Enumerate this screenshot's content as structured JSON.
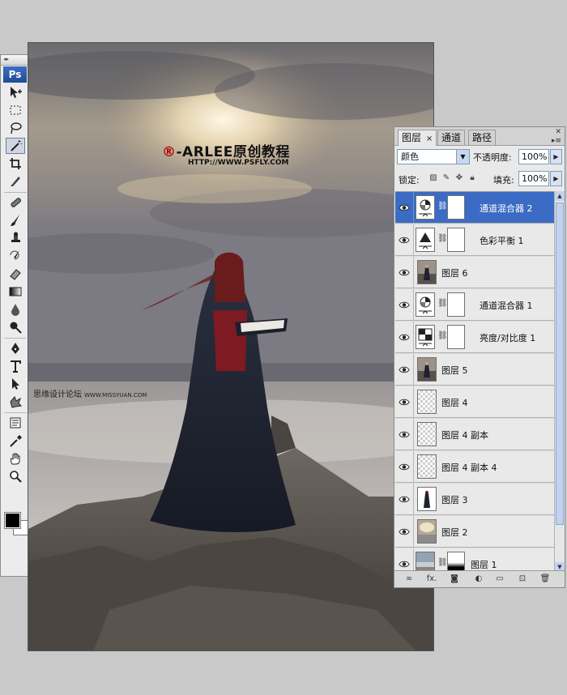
{
  "toolbar": {
    "logo": "Ps",
    "tools": [
      {
        "name": "move-tool",
        "icon": "move-icon"
      },
      {
        "name": "marquee-tool",
        "icon": "marquee-icon"
      },
      {
        "name": "lasso-tool",
        "icon": "lasso-icon"
      },
      {
        "name": "magic-wand-tool",
        "icon": "magic-wand-icon",
        "active": true
      },
      {
        "name": "crop-tool",
        "icon": "crop-icon"
      },
      {
        "name": "slice-tool",
        "icon": "slice-icon"
      },
      {
        "name": "healing-brush-tool",
        "icon": "bandage-icon"
      },
      {
        "name": "brush-tool",
        "icon": "brush-icon"
      },
      {
        "name": "clone-stamp-tool",
        "icon": "stamp-icon"
      },
      {
        "name": "history-brush-tool",
        "icon": "history-brush-icon"
      },
      {
        "name": "eraser-tool",
        "icon": "eraser-icon"
      },
      {
        "name": "gradient-tool",
        "icon": "gradient-icon"
      },
      {
        "name": "blur-tool",
        "icon": "blur-drop-icon"
      },
      {
        "name": "dodge-tool",
        "icon": "dodge-icon"
      },
      {
        "name": "pen-tool",
        "icon": "pen-icon"
      },
      {
        "name": "type-tool",
        "icon": "type-icon"
      },
      {
        "name": "path-selection-tool",
        "icon": "arrow-icon"
      },
      {
        "name": "shape-tool",
        "icon": "custom-shape-icon"
      },
      {
        "name": "notes-tool",
        "icon": "notes-icon"
      },
      {
        "name": "eyedropper-tool",
        "icon": "eyedropper-icon"
      },
      {
        "name": "hand-tool",
        "icon": "hand-icon"
      },
      {
        "name": "zoom-tool",
        "icon": "zoom-icon"
      }
    ],
    "foreground_color": "#000000",
    "background_color": "#ffffff"
  },
  "canvas": {
    "brand_symbol": "®",
    "brand_text": "-ARLEE原创教程",
    "brand_url": "HTTP://WWW.PSFLY.COM",
    "watermark_text": "思缘设计论坛",
    "watermark_url": "WWW.MISSYUAN.COM"
  },
  "layers_panel": {
    "tabs": [
      {
        "label": "图层",
        "active": true
      },
      {
        "label": "通道",
        "active": false
      },
      {
        "label": "路径",
        "active": false
      }
    ],
    "tab_close": "×",
    "blend_mode": "颜色",
    "opacity_label": "不透明度:",
    "opacity_value": "100%",
    "lock_label": "锁定:",
    "fill_label": "填充:",
    "fill_value": "100%",
    "layers": [
      {
        "name": "通道混合器 2",
        "thumb": "channel-mixer",
        "mask": true,
        "selected": true
      },
      {
        "name": "色彩平衡 1",
        "thumb": "color-balance",
        "mask": true,
        "selected": false
      },
      {
        "name": "图层 6",
        "thumb": "photo-girl",
        "mask": false,
        "selected": false
      },
      {
        "name": "通道混合器 1",
        "thumb": "channel-mixer",
        "mask": true,
        "selected": false
      },
      {
        "name": "亮度/对比度 1",
        "thumb": "brightness",
        "mask": true,
        "selected": false
      },
      {
        "name": "图层 5",
        "thumb": "photo-girl",
        "mask": false,
        "selected": false
      },
      {
        "name": "图层 4",
        "thumb": "transparent",
        "mask": false,
        "selected": false
      },
      {
        "name": "图层 4 副本",
        "thumb": "transparent",
        "mask": false,
        "selected": false
      },
      {
        "name": "图层 4 副本 4",
        "thumb": "transparent",
        "mask": false,
        "selected": false
      },
      {
        "name": "图层 3",
        "thumb": "figure",
        "mask": false,
        "selected": false
      },
      {
        "name": "图层 2",
        "thumb": "sky",
        "mask": false,
        "selected": false
      },
      {
        "name": "图层 1",
        "thumb": "photo-sea",
        "mask": true,
        "selected": false
      }
    ],
    "bottom_buttons": [
      {
        "name": "link-layers-button",
        "icon": "link-icon",
        "glyph": "∞"
      },
      {
        "name": "add-style-button",
        "icon": "fx-icon",
        "glyph": "fx."
      },
      {
        "name": "add-mask-button",
        "icon": "mask-icon",
        "glyph": "◙"
      },
      {
        "name": "new-adjustment-button",
        "icon": "half-circle-icon",
        "glyph": "◐"
      },
      {
        "name": "new-group-button",
        "icon": "folder-icon",
        "glyph": "▭"
      },
      {
        "name": "new-layer-button",
        "icon": "new-layer-icon",
        "glyph": "⊡"
      },
      {
        "name": "delete-layer-button",
        "icon": "trash-icon",
        "glyph": "🗑"
      }
    ]
  }
}
